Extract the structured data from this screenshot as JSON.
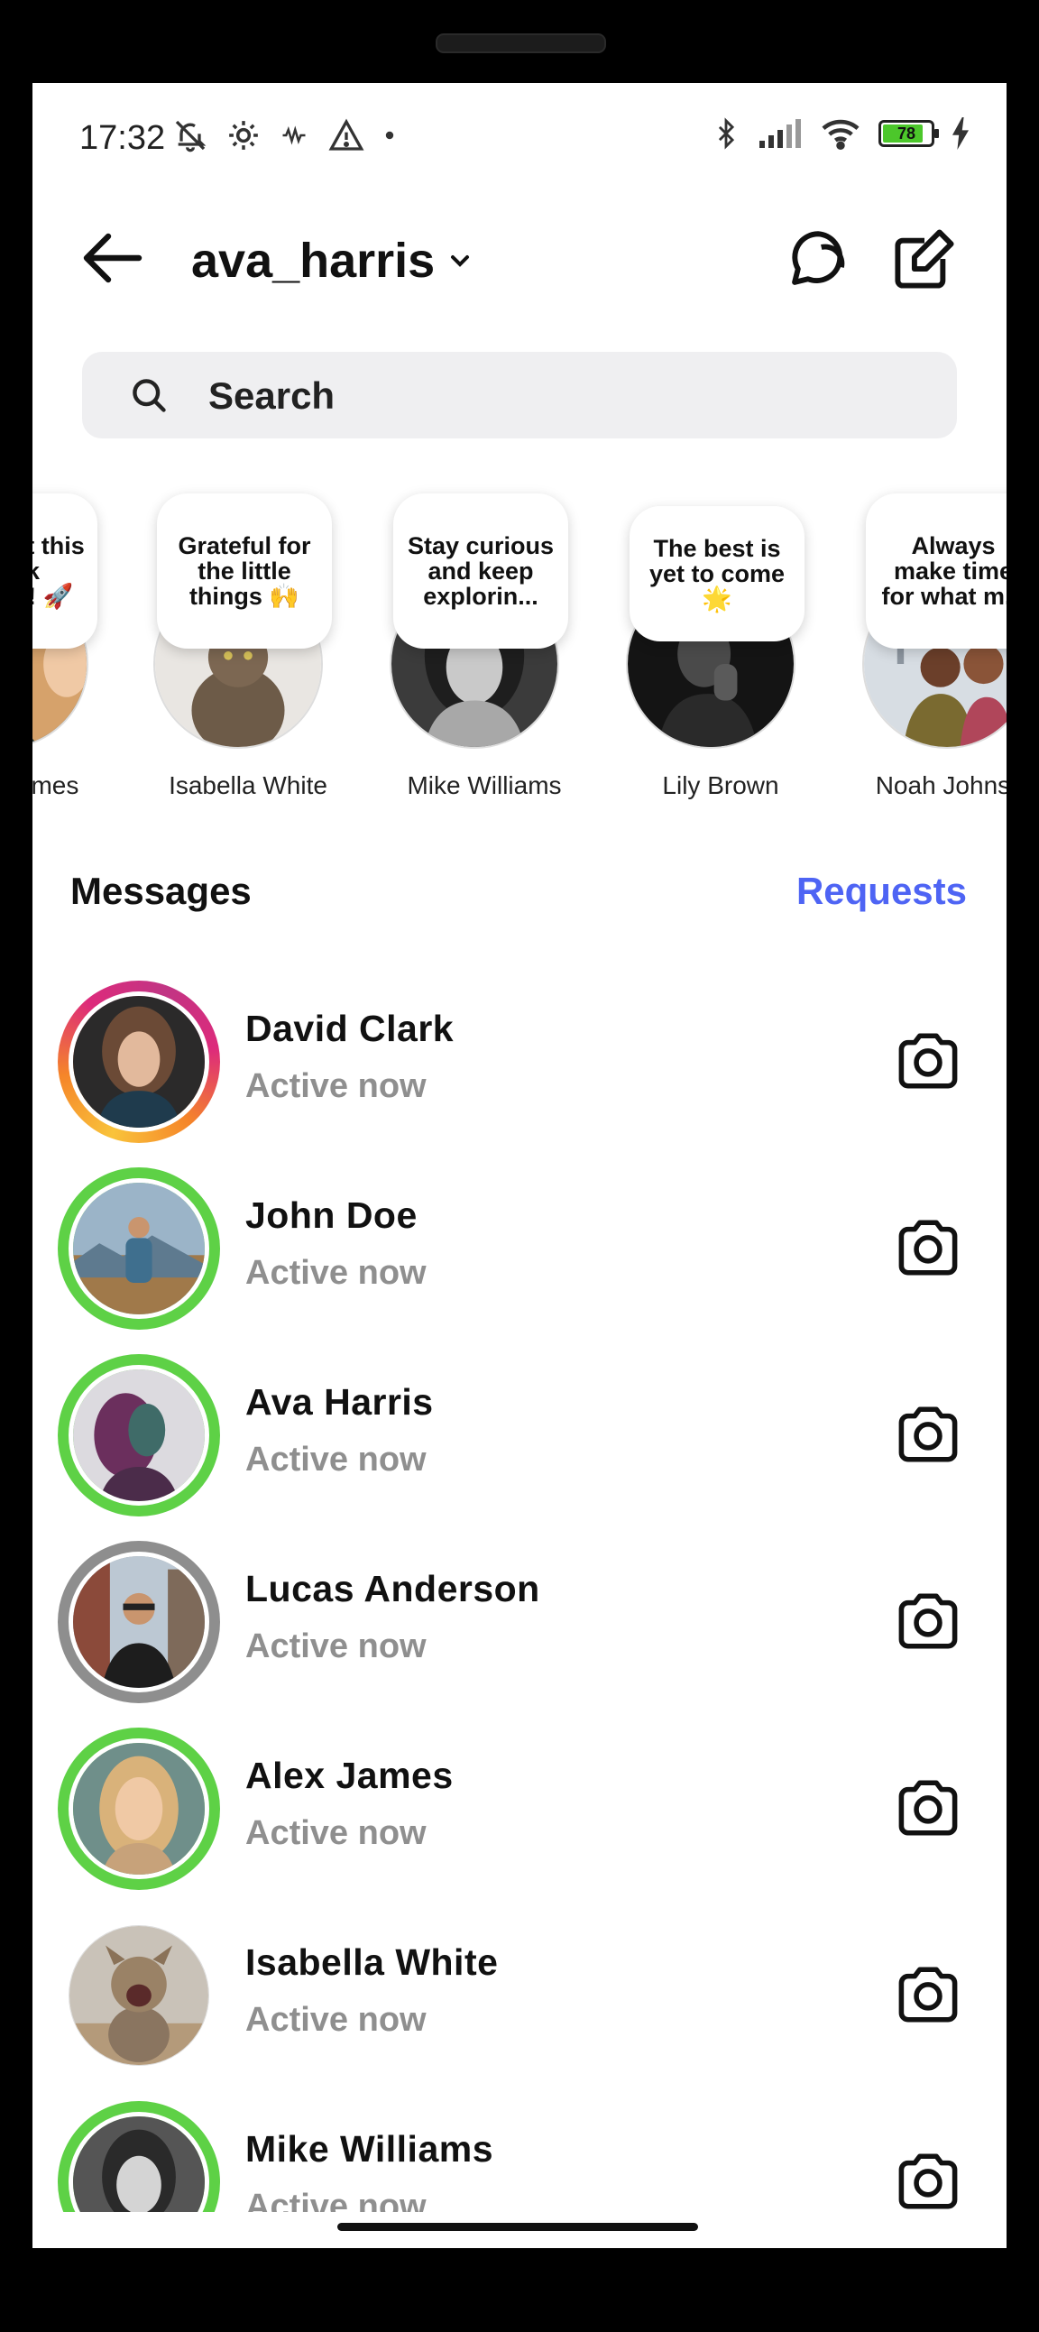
{
  "status_bar": {
    "time": "17:32",
    "battery": "78"
  },
  "header": {
    "username": "ava_harris"
  },
  "search": {
    "placeholder": "Search"
  },
  "stories": [
    {
      "name": "Alex James",
      "note": "Let's get this week started! 🚀"
    },
    {
      "name": "Isabella White",
      "note": "Grateful for the little things 🙌"
    },
    {
      "name": "Mike Williams",
      "note": "Stay curious and keep explorin..."
    },
    {
      "name": "Lily Brown",
      "note": "The best is yet to come 🌟"
    },
    {
      "name": "Noah Johnson",
      "note": "Always make time for what m..."
    }
  ],
  "messages": {
    "title": "Messages",
    "requests_label": "Requests",
    "rows": [
      {
        "name": "David Clark",
        "status": "Active now",
        "ring": "gradient"
      },
      {
        "name": "John Doe",
        "status": "Active now",
        "ring": "green"
      },
      {
        "name": "Ava Harris",
        "status": "Active now",
        "ring": "green"
      },
      {
        "name": "Lucas Anderson",
        "status": "Active now",
        "ring": "gray"
      },
      {
        "name": "Alex James",
        "status": "Active now",
        "ring": "green"
      },
      {
        "name": "Isabella White",
        "status": "Active now",
        "ring": "none"
      },
      {
        "name": "Mike Williams",
        "status": "Active now",
        "ring": "green"
      }
    ]
  },
  "colors": {
    "accent": "#4e64f4",
    "active_ring": "#5ed146",
    "muted": "#8f8f8f"
  }
}
